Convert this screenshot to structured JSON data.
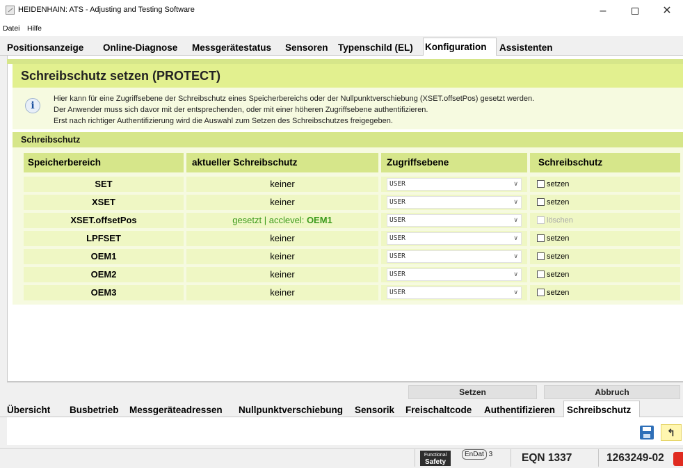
{
  "window": {
    "title": "HEIDENHAIN: ATS - Adjusting and Testing Software",
    "buttons": {
      "minimize": "–",
      "maximize": "",
      "close": "✕"
    }
  },
  "menu": [
    "Datei",
    "Hilfe"
  ],
  "top_tabs": [
    {
      "label": "Positionsanzeige"
    },
    {
      "label": "Online-Diagnose"
    },
    {
      "label": "Messgerätestatus"
    },
    {
      "label": "Sensoren"
    },
    {
      "label": "Typenschild (EL)"
    },
    {
      "label": "Konfiguration",
      "active": true
    },
    {
      "label": "Assistenten"
    }
  ],
  "page": {
    "title": "Schreibschutz setzen (PROTECT)",
    "info_lines": [
      "Hier kann für eine Zugriffsebene der Schreibschutz eines Speicherbereichs oder der Nullpunktverschiebung (XSET.offsetPos) gesetzt werden.",
      "Der Anwender muss sich davor mit der entsprechenden, oder mit einer höheren Zugriffsebene authentifizieren.",
      "Erst nach richtiger Authentifizierung wird die Auswahl zum Setzen des Schreibschutzes freigegeben."
    ],
    "section_title": "Schreibschutz"
  },
  "table": {
    "headers": [
      "Speicherbereich",
      "aktueller Schreibschutz",
      "Zugriffsebene",
      "Schreibschutz"
    ],
    "rows": [
      {
        "area": "SET",
        "current": "keiner",
        "level": "USER",
        "checkbox": "setzen",
        "disabled": false
      },
      {
        "area": "XSET",
        "current": "keiner",
        "level": "USER",
        "checkbox": "setzen",
        "disabled": false
      },
      {
        "area": "XSET.offsetPos",
        "current": "gesetzt | acclevel: ",
        "current_strong": "OEM1",
        "level": "USER",
        "checkbox": "löschen",
        "disabled": true
      },
      {
        "area": "LPFSET",
        "current": "keiner",
        "level": "USER",
        "checkbox": "setzen",
        "disabled": false
      },
      {
        "area": "OEM1",
        "current": "keiner",
        "level": "USER",
        "checkbox": "setzen",
        "disabled": false
      },
      {
        "area": "OEM2",
        "current": "keiner",
        "level": "USER",
        "checkbox": "setzen",
        "disabled": false
      },
      {
        "area": "OEM3",
        "current": "keiner",
        "level": "USER",
        "checkbox": "setzen",
        "disabled": false
      }
    ]
  },
  "buttons": {
    "set": "Setzen",
    "cancel": "Abbruch"
  },
  "bottom_tabs": [
    {
      "label": "Übersicht"
    },
    {
      "label": "Busbetrieb"
    },
    {
      "label": "Messgeräteadressen"
    },
    {
      "label": "Nullpunktverschiebung"
    },
    {
      "label": "Sensorik"
    },
    {
      "label": "Freischaltcode"
    },
    {
      "label": "Authentifizieren"
    },
    {
      "label": "Schreibschutz",
      "active": true
    }
  ],
  "status": {
    "fs_top": "Functional",
    "fs_bottom": "Safety",
    "endat": "EnDat",
    "endat_version": "3",
    "device": "EQN 1337",
    "id": "1263249-02"
  },
  "icons": {
    "info": "info-icon",
    "save": "save-icon",
    "back": "back-arrow-icon",
    "chevron": "chevron-down-icon",
    "alert": "red-status-icon"
  },
  "colors": {
    "header_bg": "#e2f08f",
    "section_bg": "#d6e68a",
    "row_bg": "#eff7c4",
    "info_bg": "#f6fae0",
    "green_text": "#3b9a1b"
  }
}
